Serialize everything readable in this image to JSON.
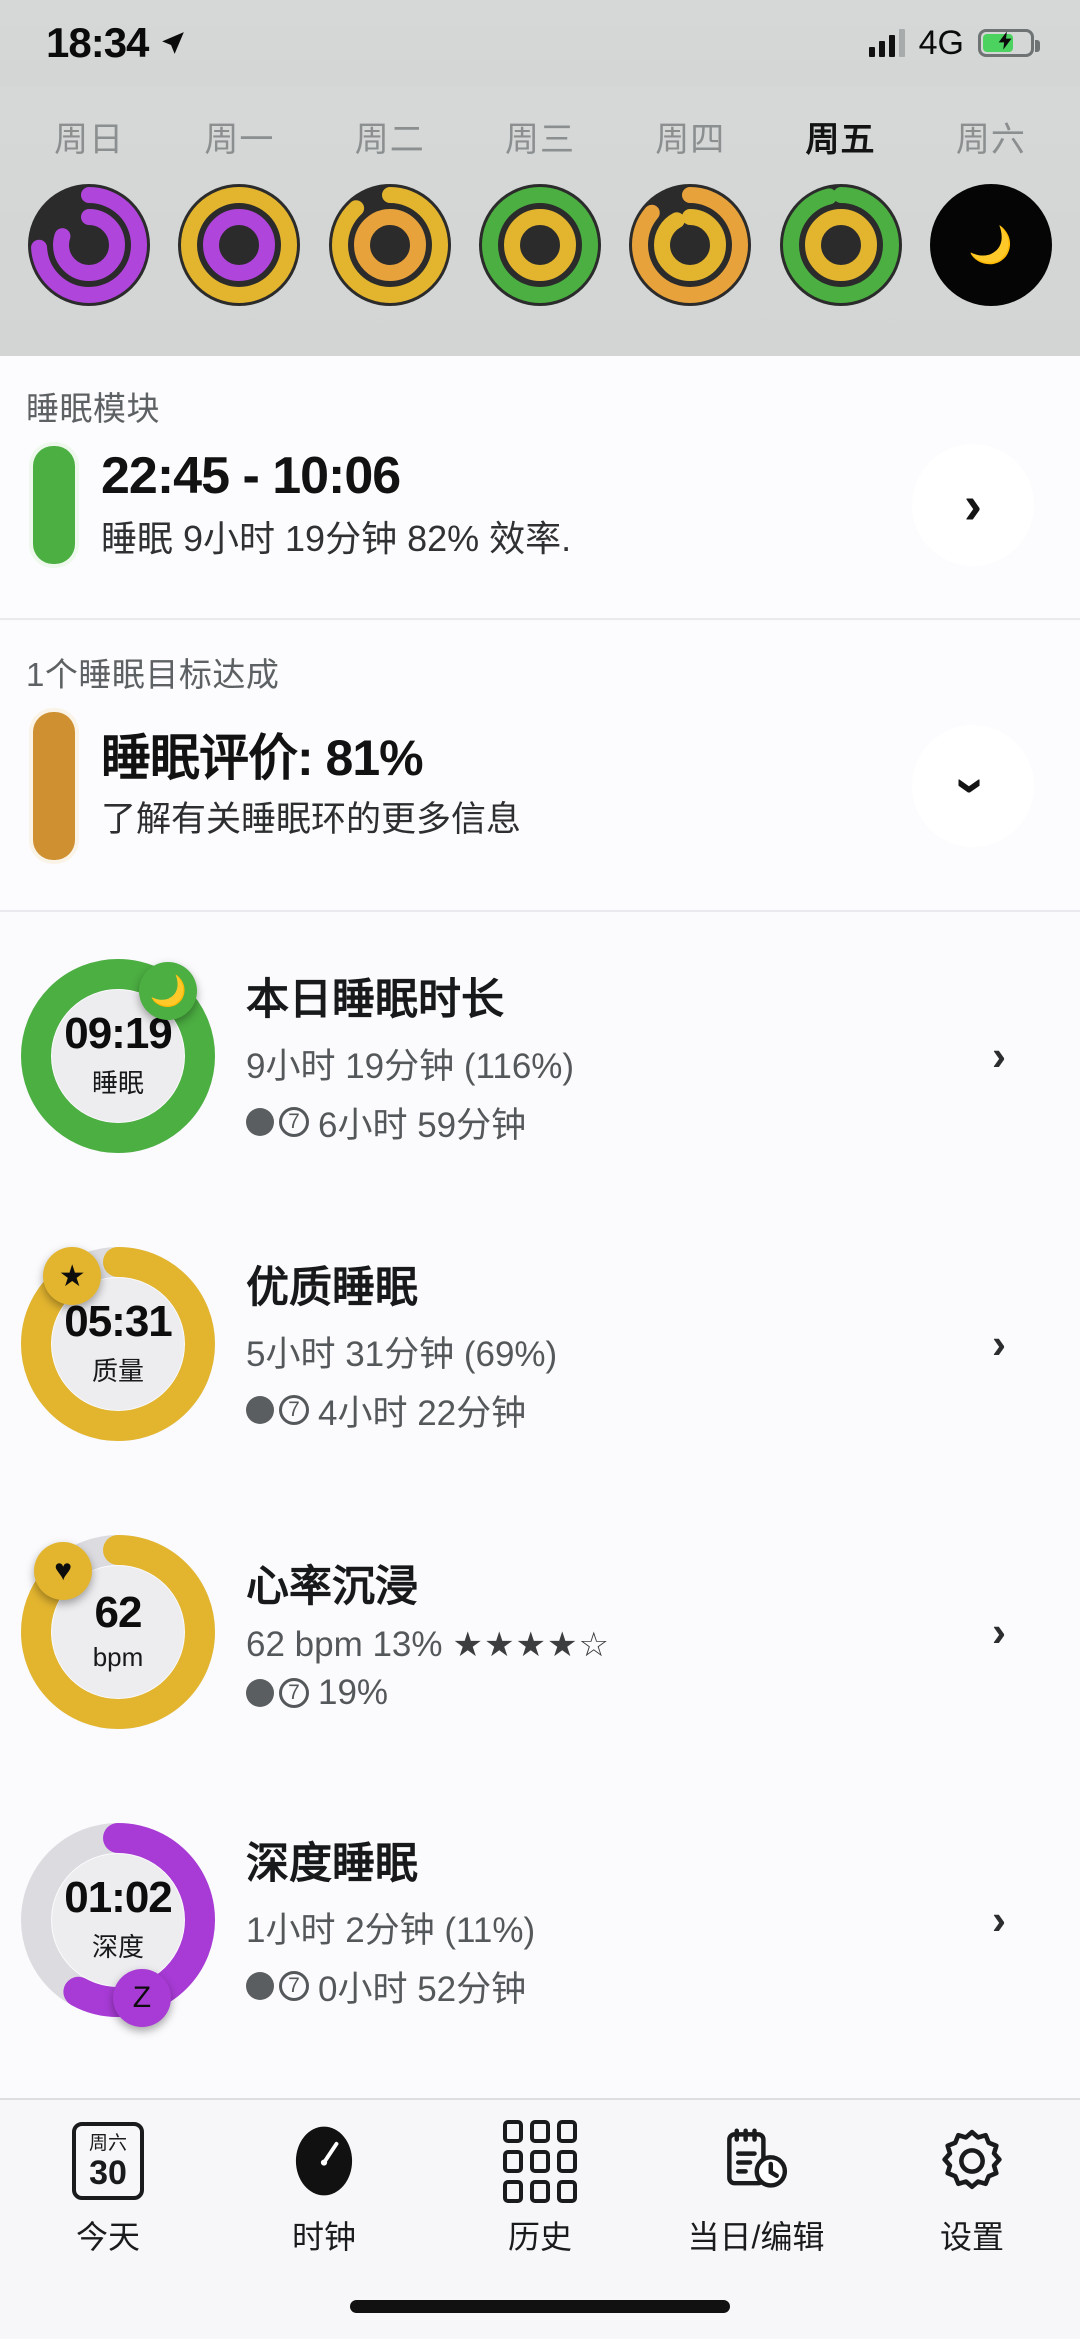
{
  "status_bar": {
    "time": "18:34",
    "location_icon": "location-arrow-icon",
    "network": "4G",
    "signal_icon": "signal-bars-icon",
    "battery_icon": "battery-charging-icon",
    "battery_level": 60
  },
  "week_strip": {
    "days": [
      {
        "label": "周日",
        "active": false,
        "type": "rings",
        "outer_color": "#b045db",
        "outer_pct": 74,
        "inner_color": "#b045db",
        "inner_pct": 80,
        "bg": "#2b2b2b"
      },
      {
        "label": "周一",
        "active": false,
        "type": "rings",
        "outer_color": "#e3b52f",
        "outer_pct": 100,
        "inner_color": "#b045db",
        "inner_pct": 100,
        "bg": "#2b2b2b"
      },
      {
        "label": "周二",
        "active": false,
        "type": "rings",
        "outer_color": "#e3b52f",
        "outer_pct": 88,
        "inner_color": "#e8a23c",
        "inner_pct": 100,
        "bg": "#2b2b2b"
      },
      {
        "label": "周三",
        "active": false,
        "type": "rings",
        "outer_color": "#4caf42",
        "outer_pct": 100,
        "inner_color": "#e3b52f",
        "inner_pct": 100,
        "bg": "#2b2b2b"
      },
      {
        "label": "周四",
        "active": false,
        "type": "rings",
        "outer_color": "#e8a23c",
        "outer_pct": 86,
        "inner_color": "#e3b52f",
        "inner_pct": 92,
        "bg": "#2b2b2b"
      },
      {
        "label": "周五",
        "active": true,
        "type": "rings",
        "outer_color": "#4caf42",
        "outer_pct": 96,
        "inner_color": "#e3b52f",
        "inner_pct": 100,
        "bg": "#2b2b2b"
      },
      {
        "label": "周六",
        "active": false,
        "type": "moon",
        "moon_glyph": "🌙",
        "bg": "#050505"
      }
    ]
  },
  "sleep_module": {
    "section_label": "睡眠模块",
    "bar_color": "#4caf42",
    "time_range": "22:45 - 10:06",
    "summary": "睡眠 9小时 19分钟 82% 效率.",
    "chevron_icon": "chevron-right-icon"
  },
  "sleep_score": {
    "section_label": "1个睡眠目标达成",
    "bar_color": "#cf9031",
    "title": "睡眠评价: 81%",
    "subtitle": "了解有关睡眠环的更多信息",
    "chevron_icon": "chevron-down-icon"
  },
  "metrics": [
    {
      "name": "sleep-duration",
      "ring_value": "09:19",
      "ring_unit": "睡眠",
      "ring_color": "#4caf42",
      "ring_track": "#dcdce0",
      "ring_pct": 100,
      "badge_glyph": "🌙",
      "badge_name": "moon-badge-icon",
      "badge_angle": 38,
      "title": "本日睡眠时长",
      "sub": "9小时 19分钟 (116%)",
      "avg_days": "7",
      "avg_value": "6小时 59分钟",
      "stars": null,
      "chevron_icon": "chevron-right-icon"
    },
    {
      "name": "quality-sleep",
      "ring_value": "05:31",
      "ring_unit": "质量",
      "ring_color": "#e3b52f",
      "ring_track": "#dcdce0",
      "ring_pct": 92,
      "badge_glyph": "★",
      "badge_name": "star-badge-icon",
      "badge_angle": -34,
      "title": "优质睡眠",
      "sub": "5小时 31分钟 (69%)",
      "avg_days": "7",
      "avg_value": "4小时 22分钟",
      "stars": null,
      "chevron_icon": "chevron-right-icon"
    },
    {
      "name": "heart-rate-dip",
      "ring_value": "62",
      "ring_unit": "bpm",
      "ring_color": "#e3b52f",
      "ring_track": "#dcdce0",
      "ring_pct": 86,
      "badge_glyph": "♥",
      "badge_name": "heart-badge-icon",
      "badge_angle": -42,
      "title": "心率沉浸",
      "sub": "62 bpm 13%",
      "avg_days": "7",
      "avg_value": "19%",
      "stars": {
        "filled": 4,
        "empty": 1,
        "filled_glyph": "★",
        "empty_glyph": "☆"
      },
      "chevron_icon": "chevron-right-icon"
    },
    {
      "name": "deep-sleep",
      "ring_value": "01:02",
      "ring_unit": "深度",
      "ring_color": "#a83bd6",
      "ring_track": "#dcdce0",
      "ring_pct": 58,
      "badge_glyph": "Z",
      "badge_name": "z-badge-icon",
      "badge_angle": 163,
      "title": "深度睡眠",
      "sub": "1小时 2分钟 (11%)",
      "avg_days": "7",
      "avg_value": "0小时 52分钟",
      "stars": null,
      "chevron_icon": "chevron-right-icon"
    }
  ],
  "tab_bar": {
    "items": [
      {
        "name": "today",
        "icon": "calendar-icon",
        "cal_weekday": "周六",
        "cal_day": "30",
        "label": "今天",
        "active": false
      },
      {
        "name": "clock",
        "icon": "clock-gauge-icon",
        "label": "时钟",
        "active": true
      },
      {
        "name": "history",
        "icon": "grid-icon",
        "label": "历史",
        "active": false
      },
      {
        "name": "day-edit",
        "icon": "clipboard-clock-icon",
        "label": "当日/编辑",
        "active": false
      },
      {
        "name": "settings",
        "icon": "gear-icon",
        "label": "设置",
        "active": false
      }
    ]
  }
}
